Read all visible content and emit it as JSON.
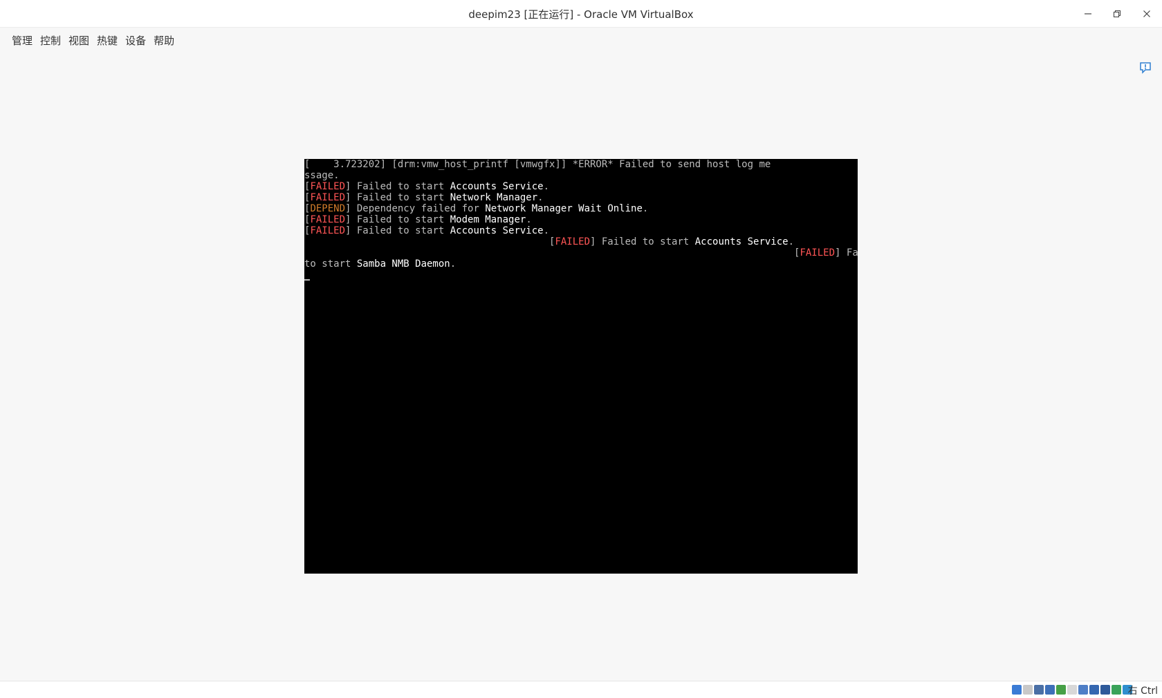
{
  "window": {
    "title": "deepim23 [正在运行] - Oracle VM VirtualBox",
    "buttons": {
      "minimize": "minimize-icon",
      "restore": "restore-icon",
      "close": "close-icon"
    }
  },
  "menu": [
    {
      "label": "管理"
    },
    {
      "label": "控制"
    },
    {
      "label": "视图"
    },
    {
      "label": "热键"
    },
    {
      "label": "设备"
    },
    {
      "label": "帮助"
    }
  ],
  "console": {
    "lines": [
      [
        {
          "t": "[    3.723202] [drm:vmw_host_printf [vmwgfx]] *ERROR* Failed to send host log me",
          "c": ""
        }
      ],
      [
        {
          "t": "ssage.",
          "c": ""
        }
      ],
      [
        {
          "t": "[",
          "c": ""
        },
        {
          "t": "FAILED",
          "c": "r"
        },
        {
          "t": "] Failed to start ",
          "c": ""
        },
        {
          "t": "Accounts Service",
          "c": "w"
        },
        {
          "t": ".",
          "c": ""
        }
      ],
      [
        {
          "t": "[",
          "c": ""
        },
        {
          "t": "FAILED",
          "c": "r"
        },
        {
          "t": "] Failed to start ",
          "c": ""
        },
        {
          "t": "Network Manager",
          "c": "w"
        },
        {
          "t": ".",
          "c": ""
        }
      ],
      [
        {
          "t": "[",
          "c": ""
        },
        {
          "t": "DEPEND",
          "c": "o"
        },
        {
          "t": "] Dependency failed for ",
          "c": ""
        },
        {
          "t": "Network Manager Wait Online",
          "c": "w"
        },
        {
          "t": ".",
          "c": ""
        }
      ],
      [
        {
          "t": "[",
          "c": ""
        },
        {
          "t": "FAILED",
          "c": "r"
        },
        {
          "t": "] Failed to start ",
          "c": ""
        },
        {
          "t": "Modem Manager",
          "c": "w"
        },
        {
          "t": ".",
          "c": ""
        }
      ],
      [
        {
          "t": "[",
          "c": ""
        },
        {
          "t": "FAILED",
          "c": "r"
        },
        {
          "t": "] Failed to start ",
          "c": ""
        },
        {
          "t": "Accounts Service",
          "c": "w"
        },
        {
          "t": ".",
          "c": ""
        }
      ],
      [
        {
          "t": "                                          [",
          "c": ""
        },
        {
          "t": "FAILED",
          "c": "r"
        },
        {
          "t": "] Failed to start ",
          "c": ""
        },
        {
          "t": "Accounts Service",
          "c": "w"
        },
        {
          "t": ".",
          "c": ""
        }
      ],
      [
        {
          "t": "                                                                                    [",
          "c": ""
        },
        {
          "t": "FAILED",
          "c": "r"
        },
        {
          "t": "] Failed",
          "c": ""
        }
      ],
      [
        {
          "t": "to start ",
          "c": ""
        },
        {
          "t": "Samba NMB Daemon",
          "c": "w"
        },
        {
          "t": ".",
          "c": ""
        }
      ]
    ]
  },
  "statusbar": {
    "icons": [
      {
        "name": "hard-disk-icon",
        "color": "#3a7bd5"
      },
      {
        "name": "optical-drive-icon",
        "color": "#c8c8c8"
      },
      {
        "name": "audio-icon",
        "color": "#4a6fa5"
      },
      {
        "name": "network-icon",
        "color": "#3d6fb8"
      },
      {
        "name": "usb-icon",
        "color": "#46a046"
      },
      {
        "name": "shared-folders-icon",
        "color": "#d8d8d8"
      },
      {
        "name": "display-icon",
        "color": "#4f7fc7"
      },
      {
        "name": "video-capture-icon",
        "color": "#3567b0"
      },
      {
        "name": "cpu-virtualization-icon",
        "color": "#2e5a9a"
      },
      {
        "name": "guest-additions-icon",
        "color": "#3aa35a"
      },
      {
        "name": "mouse-integration-icon",
        "color": "#2f8fcf"
      }
    ],
    "host_key": "右 Ctrl"
  }
}
